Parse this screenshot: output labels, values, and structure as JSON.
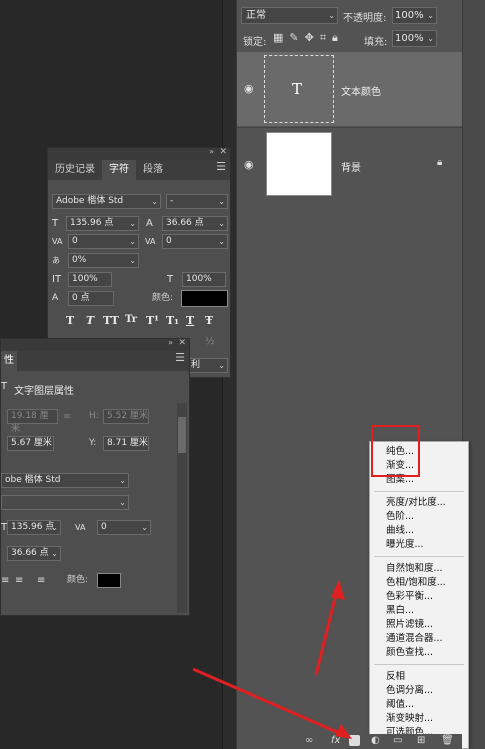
{
  "layers_panel": {
    "blend_mode": "正常",
    "opacity_label": "不透明度:",
    "opacity_value": "100%",
    "lock_label": "锁定:",
    "fill_label": "填充:",
    "fill_value": "100%",
    "layers": [
      {
        "name": "文本颜色",
        "thumb_glyph": "T"
      },
      {
        "name": "背景"
      }
    ]
  },
  "character_panel": {
    "tabs": [
      "历史记录",
      "字符",
      "段落"
    ],
    "font_family": "Adobe 楷体 Std",
    "font_style": "-",
    "font_size": "135.96 点",
    "leading": "36.66 点",
    "kerning": "0",
    "tracking": "0",
    "scale_percent": "0%",
    "vertical_scale": "100%",
    "horizontal_scale": "100%",
    "baseline_shift": "0 点",
    "color_label": "颜色:",
    "text_styles": [
      "T",
      "T",
      "TT",
      "Tr",
      "T¹",
      "T₁",
      "T",
      "Ŧ"
    ],
    "partial_right": "利",
    "partial_frac": "½"
  },
  "properties_panel": {
    "tab_label": "性",
    "title": "文字图层属性",
    "w_value": "19.18 厘米",
    "h_label": "H:",
    "h_value": "5.52 厘米",
    "x_value": "5.67 厘米",
    "y_label": "Y:",
    "y_value": "8.71 厘米",
    "font_family": "obe 楷体 Std",
    "font_size": "135.96 点",
    "tracking": "0",
    "leading": "36.66 点",
    "color_label": "颜色:"
  },
  "adjust_menu": {
    "group1": [
      "纯色...",
      "渐变...",
      "图案..."
    ],
    "group2": [
      "亮度/对比度...",
      "色阶...",
      "曲线...",
      "曝光度..."
    ],
    "group3": [
      "自然饱和度...",
      "色相/饱和度...",
      "色彩平衡...",
      "黑白...",
      "照片滤镜...",
      "通道混合器...",
      "颜色查找..."
    ],
    "group4": [
      "反相",
      "色调分离...",
      "阈值...",
      "渐变映射...",
      "可选颜色..."
    ]
  },
  "bottom_bar": {
    "fx_label": "fx"
  }
}
